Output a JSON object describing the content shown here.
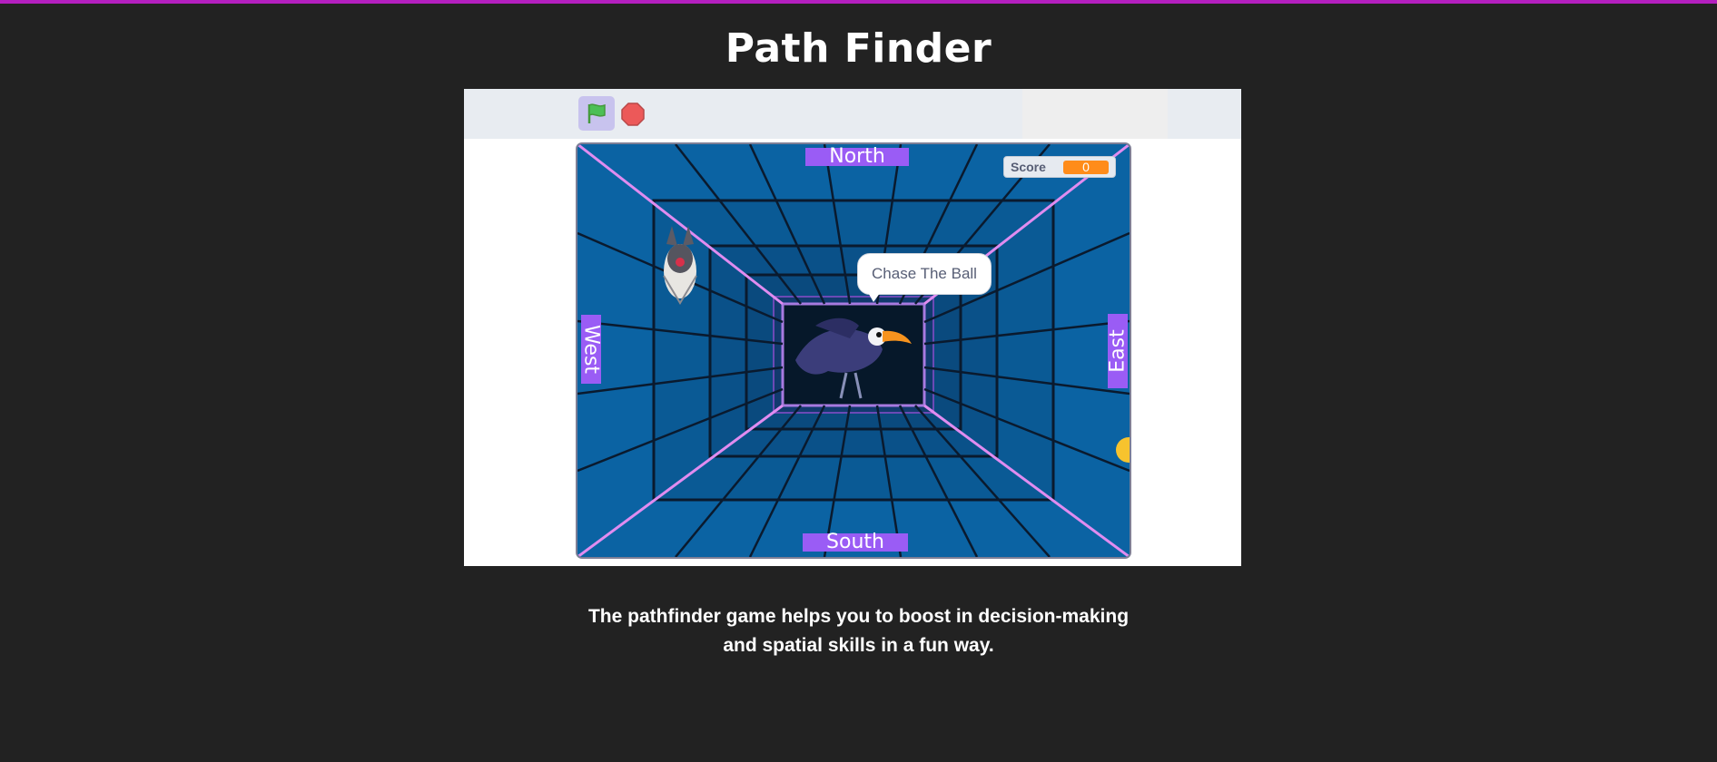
{
  "page": {
    "title": "Path Finder",
    "caption_line1": "The pathfinder game helps you to boost in decision-making",
    "caption_line2": "and spatial skills in a fun way."
  },
  "player": {
    "controls": {
      "green_flag_icon": "green-flag-icon",
      "stop_icon": "stop-sign-icon"
    },
    "stage": {
      "labels": {
        "north": "North",
        "south": "South",
        "west": "West",
        "east": "East"
      },
      "score": {
        "label": "Score",
        "value": "0"
      },
      "speech_bubble": "Chase The Ball",
      "sprites": [
        "bat-sprite",
        "toucan-sprite",
        "ball-sprite"
      ]
    }
  },
  "colors": {
    "background": "#222222",
    "accent_border": "#b41fbf",
    "direction_label": "#9a5cf5",
    "score_value": "#ff8c1a",
    "stage_blue": "#0b63a3"
  }
}
